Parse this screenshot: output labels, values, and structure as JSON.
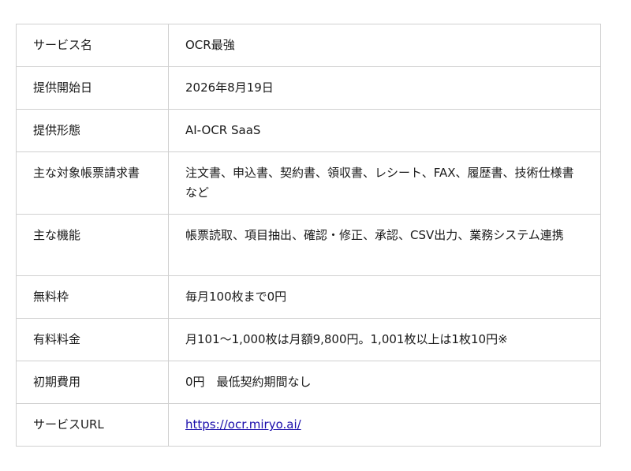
{
  "rows": [
    {
      "label": "サービス名",
      "value": "OCR最強"
    },
    {
      "label": "提供開始日",
      "value": "2026年8月19日"
    },
    {
      "label": "提供形態",
      "value": "AI-OCR SaaS"
    },
    {
      "label": "主な対象帳票請求書",
      "value": "注文書、申込書、契約書、領収書、レシート、FAX、履歴書、技術仕様書など"
    },
    {
      "label": "主な機能",
      "value": "帳票読取、項目抽出、確認・修正、承認、CSV出力、業務システム連携"
    },
    {
      "label": "無料枠",
      "value": "毎月100枚まで0円"
    },
    {
      "label": "有料料金",
      "value": "月101〜1,000枚は月額9,800円。1,001枚以上は1枚10円※"
    },
    {
      "label": "初期費用",
      "value": "0円　最低契約期間なし"
    },
    {
      "label": "サービスURL",
      "value": "https://ocr.miryo.ai/"
    }
  ]
}
